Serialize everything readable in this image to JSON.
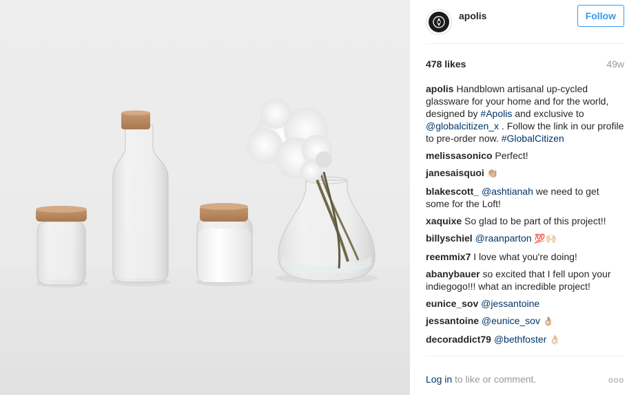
{
  "post": {
    "username": "apolis",
    "follow_label": "Follow",
    "likes": "478 likes",
    "age": "49w",
    "caption": {
      "user": "apolis",
      "text_1": " Handblown artisanal up-cycled glassware for your home and for the world, designed by ",
      "tag_1": "#Apolis",
      "text_2": " and exclusive to ",
      "tag_2": "@globalcitizen_x",
      "text_3": " . Follow the link in our profile to pre-order now. ",
      "tag_3": "#GlobalCitizen"
    }
  },
  "comments": [
    {
      "user": "melissasonico",
      "text": " Perfect!"
    },
    {
      "user": "janesaisquoi",
      "text": " ",
      "emoji": "👏🏼"
    },
    {
      "user": "blakescott_",
      "mention": "@ashtianah",
      "text": " we need to get some for the Loft!"
    },
    {
      "user": "xaquixe",
      "text": " So glad to be part of this project!!"
    },
    {
      "user": "billyschiel",
      "mention": "@raanparton",
      "text": " ",
      "emoji": "💯🙌🏻"
    },
    {
      "user": "reemmix7",
      "text": " I love what you're doing!"
    },
    {
      "user": "abanybauer",
      "text": " so excited that I fell upon your indiegogo!!! what an incredible project!"
    },
    {
      "user": "eunice_sov",
      "mention": "@jessantoine",
      "text": ""
    },
    {
      "user": "jessantoine",
      "mention": "@eunice_sov",
      "text": " ",
      "emoji": "👌🏼"
    },
    {
      "user": "decoraddict79",
      "mention": "@bethfoster",
      "text": " ",
      "emoji": "👌🏻"
    }
  ],
  "footer": {
    "login_label": "Log in",
    "rest_label": " to like or comment.",
    "more_label": "ooo"
  },
  "icons": {
    "avatar": "apolis-logo-icon",
    "more": "more-options-icon"
  },
  "colors": {
    "link": "#003569",
    "follow": "#3897f0",
    "muted": "#999999"
  }
}
